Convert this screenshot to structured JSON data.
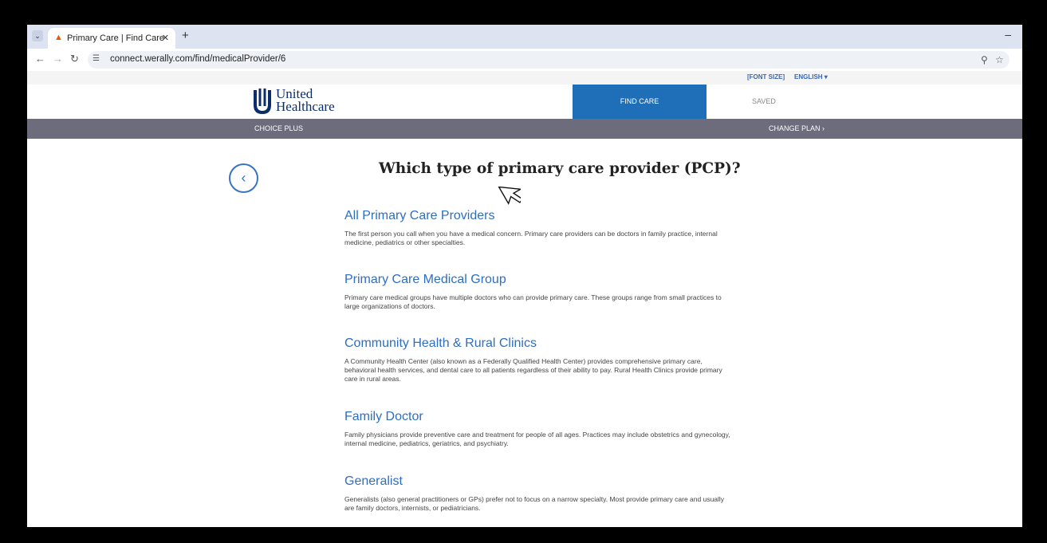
{
  "browser": {
    "tab_title": "Primary Care | Find Care",
    "url": "connect.werally.com/find/medicalProvider/6"
  },
  "utility": {
    "font_size": "[FONT SIZE]",
    "language": "ENGLISH ▾"
  },
  "header": {
    "logo_line1": "United",
    "logo_line2": "Healthcare",
    "find_care": "FIND CARE",
    "saved": "SAVED"
  },
  "plan_bar": {
    "plan_name": "CHOICE PLUS",
    "change_plan": "CHANGE PLAN ›"
  },
  "main": {
    "title": "Which type of primary care provider (PCP)?",
    "options": [
      {
        "title": "All Primary Care Providers",
        "description": "The first person you call when you have a medical concern. Primary care providers can be doctors in family practice, internal medicine, pediatrics or other specialties."
      },
      {
        "title": "Primary Care Medical Group",
        "description": "Primary care medical groups have multiple doctors who can provide primary care. These groups range from small practices to large organizations of doctors."
      },
      {
        "title": "Community Health & Rural Clinics",
        "description": "A Community Health Center (also known as a Federally Qualified Health Center) provides comprehensive primary care, behavioral health services, and dental care to all patients regardless of their ability to pay. Rural Health Clinics provide primary care in rural areas."
      },
      {
        "title": "Family Doctor",
        "description": "Family physicians provide preventive care and treatment for people of all ages. Practices may include obstetrics and gynecology, internal medicine, pediatrics, geriatrics, and psychiatry."
      },
      {
        "title": "Generalist",
        "description": "Generalists (also general practitioners or GPs) prefer not to focus on a narrow specialty. Most provide primary care and usually are family doctors, internists, or pediatricians."
      }
    ]
  },
  "colors": {
    "link_blue": "#2e6ec0",
    "nav_active": "#1f6fb8",
    "plan_bar": "#6c6c7c"
  }
}
